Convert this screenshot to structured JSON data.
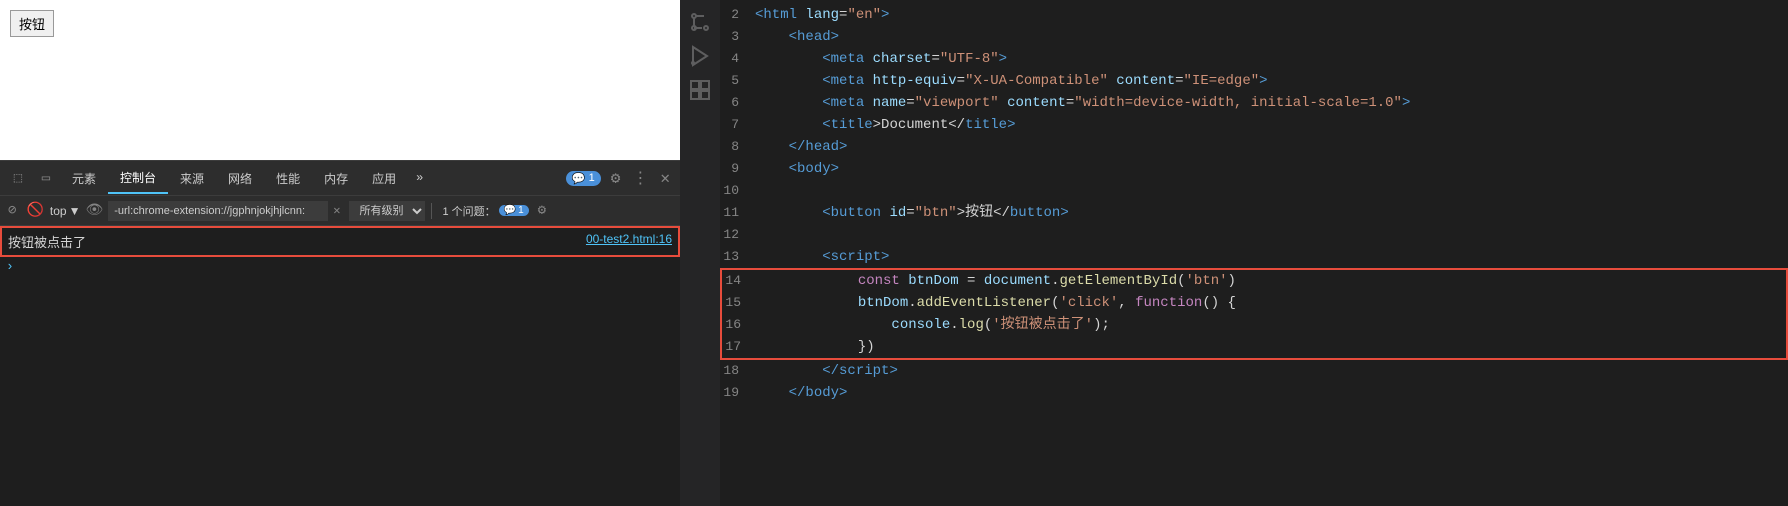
{
  "browser": {
    "button_label": "按钮"
  },
  "devtools": {
    "tabs": [
      {
        "label": "元素",
        "active": false
      },
      {
        "label": "控制台",
        "active": true
      },
      {
        "label": "来源",
        "active": false
      },
      {
        "label": "网络",
        "active": false
      },
      {
        "label": "性能",
        "active": false
      },
      {
        "label": "内存",
        "active": false
      },
      {
        "label": "应用",
        "active": false
      }
    ],
    "more_label": "»",
    "badge_count": "1",
    "toolbar": {
      "top_label": "top",
      "url_value": "-url:chrome-extension://jgphnjokjhjlcnn:",
      "filter_label": "所有级别",
      "issues_label": "1 个问题：",
      "issues_count": "1"
    },
    "console_log": {
      "text": "按钮被点击了",
      "source": "00-test2.html:16"
    }
  },
  "editor": {
    "lines": [
      {
        "num": "2",
        "tokens": [
          {
            "t": "<",
            "c": "c-tag"
          },
          {
            "t": "html",
            "c": "c-tag"
          },
          {
            "t": " lang",
            "c": "c-attr"
          },
          {
            "t": "=",
            "c": "c-punct"
          },
          {
            "t": "\"en\"",
            "c": "c-val"
          },
          {
            "t": ">",
            "c": "c-tag"
          }
        ]
      },
      {
        "num": "3",
        "tokens": [
          {
            "t": "    <",
            "c": "c-tag"
          },
          {
            "t": "head",
            "c": "c-tag"
          },
          {
            "t": ">",
            "c": "c-tag"
          }
        ]
      },
      {
        "num": "4",
        "tokens": [
          {
            "t": "        <",
            "c": "c-tag"
          },
          {
            "t": "meta",
            "c": "c-tag"
          },
          {
            "t": " charset",
            "c": "c-attr"
          },
          {
            "t": "=",
            "c": "c-punct"
          },
          {
            "t": "\"UTF-8\"",
            "c": "c-val"
          },
          {
            "t": ">",
            "c": "c-tag"
          }
        ]
      },
      {
        "num": "5",
        "tokens": [
          {
            "t": "        <",
            "c": "c-tag"
          },
          {
            "t": "meta",
            "c": "c-tag"
          },
          {
            "t": " http-equiv",
            "c": "c-attr"
          },
          {
            "t": "=",
            "c": "c-punct"
          },
          {
            "t": "\"X-UA-Compatible\"",
            "c": "c-val"
          },
          {
            "t": " content",
            "c": "c-attr"
          },
          {
            "t": "=",
            "c": "c-punct"
          },
          {
            "t": "\"IE=edge\"",
            "c": "c-val"
          },
          {
            "t": ">",
            "c": "c-tag"
          }
        ]
      },
      {
        "num": "6",
        "tokens": [
          {
            "t": "        <",
            "c": "c-tag"
          },
          {
            "t": "meta",
            "c": "c-tag"
          },
          {
            "t": " name",
            "c": "c-attr"
          },
          {
            "t": "=",
            "c": "c-punct"
          },
          {
            "t": "\"viewport\"",
            "c": "c-val"
          },
          {
            "t": " content",
            "c": "c-attr"
          },
          {
            "t": "=",
            "c": "c-punct"
          },
          {
            "t": "\"width=device-width, initial-scale=1.0\"",
            "c": "c-val"
          },
          {
            "t": ">",
            "c": "c-tag"
          }
        ]
      },
      {
        "num": "7",
        "tokens": [
          {
            "t": "        <",
            "c": "c-tag"
          },
          {
            "t": "title",
            "c": "c-tag"
          },
          {
            "t": ">Document</",
            "c": "c-text"
          },
          {
            "t": "title",
            "c": "c-tag"
          },
          {
            "t": ">",
            "c": "c-tag"
          }
        ]
      },
      {
        "num": "8",
        "tokens": [
          {
            "t": "    </",
            "c": "c-tag"
          },
          {
            "t": "head",
            "c": "c-tag"
          },
          {
            "t": ">",
            "c": "c-tag"
          }
        ]
      },
      {
        "num": "9",
        "tokens": [
          {
            "t": "    <",
            "c": "c-tag"
          },
          {
            "t": "body",
            "c": "c-tag"
          },
          {
            "t": ">",
            "c": "c-tag"
          }
        ]
      },
      {
        "num": "10",
        "tokens": []
      },
      {
        "num": "11",
        "tokens": [
          {
            "t": "        <",
            "c": "c-tag"
          },
          {
            "t": "button",
            "c": "c-tag"
          },
          {
            "t": " id",
            "c": "c-attr"
          },
          {
            "t": "=",
            "c": "c-punct"
          },
          {
            "t": "\"btn\"",
            "c": "c-val"
          },
          {
            "t": ">按钮</",
            "c": "c-text"
          },
          {
            "t": "button",
            "c": "c-tag"
          },
          {
            "t": ">",
            "c": "c-tag"
          }
        ]
      },
      {
        "num": "12",
        "tokens": []
      },
      {
        "num": "13",
        "tokens": [
          {
            "t": "        <",
            "c": "c-tag"
          },
          {
            "t": "script",
            "c": "c-tag"
          },
          {
            "t": ">",
            "c": "c-tag"
          }
        ]
      },
      {
        "num": "14",
        "tokens": [
          {
            "t": "            const ",
            "c": "c-keyword"
          },
          {
            "t": "btnDom",
            "c": "c-var"
          },
          {
            "t": " = ",
            "c": "c-punct"
          },
          {
            "t": "document",
            "c": "c-var"
          },
          {
            "t": ".",
            "c": "c-punct"
          },
          {
            "t": "getElementById",
            "c": "c-func"
          },
          {
            "t": "(",
            "c": "c-punct"
          },
          {
            "t": "'btn'",
            "c": "c-string"
          },
          {
            "t": ")",
            "c": "c-punct"
          }
        ],
        "highlight": true
      },
      {
        "num": "15",
        "tokens": [
          {
            "t": "            btnDom",
            "c": "c-var"
          },
          {
            "t": ".",
            "c": "c-punct"
          },
          {
            "t": "addEventListener",
            "c": "c-func"
          },
          {
            "t": "(",
            "c": "c-punct"
          },
          {
            "t": "'click'",
            "c": "c-string"
          },
          {
            "t": ", ",
            "c": "c-punct"
          },
          {
            "t": "function",
            "c": "c-keyword"
          },
          {
            "t": "() {",
            "c": "c-punct"
          }
        ],
        "highlight": true
      },
      {
        "num": "16",
        "tokens": [
          {
            "t": "                console",
            "c": "c-var"
          },
          {
            "t": ".",
            "c": "c-punct"
          },
          {
            "t": "log",
            "c": "c-func"
          },
          {
            "t": "(",
            "c": "c-punct"
          },
          {
            "t": "'按钮被点击了'",
            "c": "c-string"
          },
          {
            "t": ")",
            "c": "c-punct"
          },
          {
            "t": ";",
            "c": "c-punct"
          }
        ],
        "highlight": true
      },
      {
        "num": "17",
        "tokens": [
          {
            "t": "            })",
            "c": "c-punct"
          }
        ],
        "highlight": true
      },
      {
        "num": "18",
        "tokens": [
          {
            "t": "        </",
            "c": "c-tag"
          },
          {
            "t": "script",
            "c": "c-tag"
          },
          {
            "t": ">",
            "c": "c-tag"
          }
        ]
      },
      {
        "num": "19",
        "tokens": [
          {
            "t": "    </",
            "c": "c-tag"
          },
          {
            "t": "body",
            "c": "c-tag"
          },
          {
            "t": ">",
            "c": "c-tag"
          }
        ]
      }
    ]
  }
}
